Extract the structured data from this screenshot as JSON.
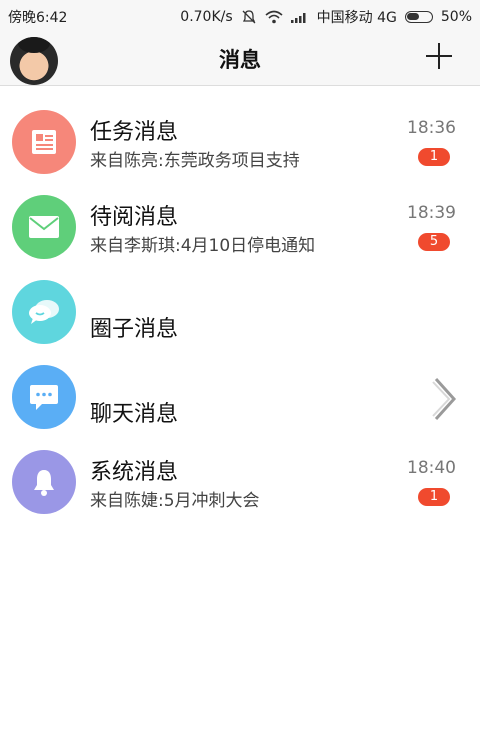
{
  "status_bar": {
    "time": "傍晚6:42",
    "speed": "0.70K/s",
    "carrier": "中国移动 4G",
    "battery": "50%"
  },
  "header": {
    "title": "消息"
  },
  "messages": [
    {
      "title": "任务消息",
      "subtitle": "来自陈亮:东莞政务项目支持",
      "time": "18:36",
      "badge": "1",
      "icon": "newspaper-icon",
      "color": "#f6877a"
    },
    {
      "title": "待阅消息",
      "subtitle": "来自李斯琪:4月10日停电通知",
      "time": "18:39",
      "badge": "5",
      "icon": "envelope-icon",
      "color": "#5fcf7a"
    },
    {
      "title": "圈子消息",
      "icon": "chat-bubbles-icon",
      "color": "#5fd6de"
    },
    {
      "title": "聊天消息",
      "icon": "chat-dots-icon",
      "color": "#5aaef5"
    },
    {
      "title": "系统消息",
      "subtitle": "来自陈婕:5月冲刺大会",
      "time": "18:40",
      "badge": "1",
      "icon": "bell-icon",
      "color": "#9a97e6"
    }
  ]
}
